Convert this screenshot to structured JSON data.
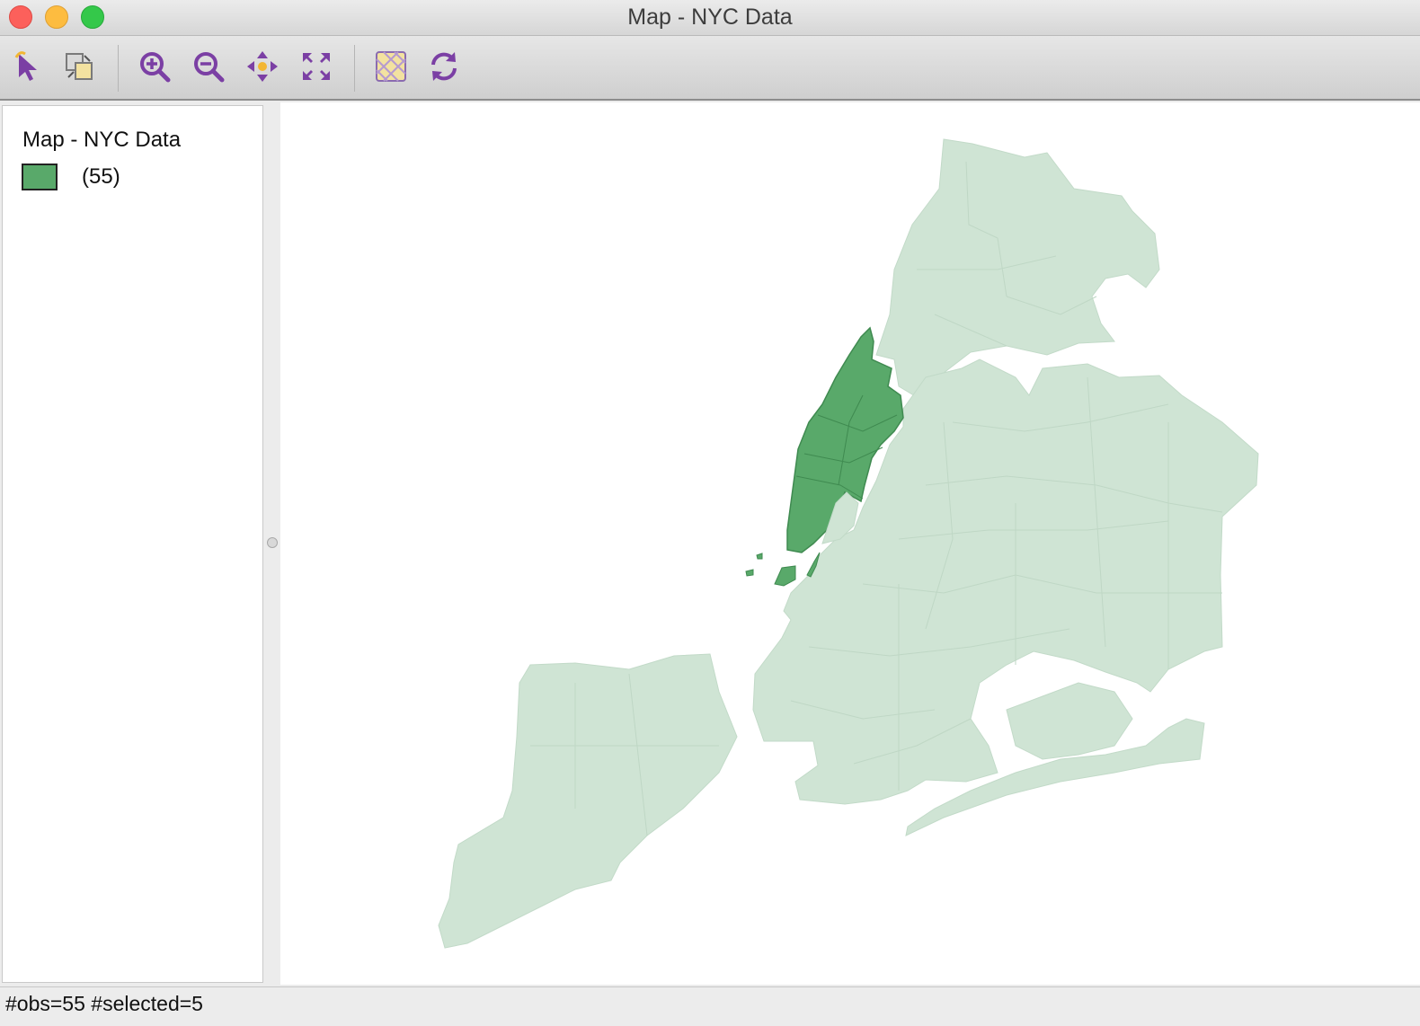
{
  "window": {
    "title": "Map - NYC Data"
  },
  "toolbar": {
    "items": [
      {
        "icon": "select-pointer-icon"
      },
      {
        "icon": "selection-mode-icon"
      },
      {
        "icon": "zoom-in-icon"
      },
      {
        "icon": "zoom-out-icon"
      },
      {
        "icon": "pan-icon"
      },
      {
        "icon": "full-extent-icon"
      },
      {
        "icon": "map-layer-icon"
      },
      {
        "icon": "refresh-icon"
      }
    ],
    "icon_color": "#7b3fa4"
  },
  "legend": {
    "title": "Map - NYC Data",
    "category_label": "(55)",
    "category_color": "#59a96a"
  },
  "map": {
    "selected_color": "#59a96a",
    "unselected_color": "#cfe4d4",
    "observations": 55,
    "selected": 5
  },
  "status": {
    "text": "#obs=55 #selected=5"
  }
}
